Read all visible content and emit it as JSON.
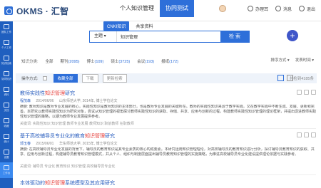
{
  "header": {
    "logo_text": "OKMS · 汇智",
    "nav": [
      "个人知识管理",
      "协同测试"
    ],
    "user_label": "办理耳",
    "user_icon": "user-icon",
    "right_items": [
      "消息",
      "退出"
    ]
  },
  "sidebar": {
    "items": [
      "团队工作",
      "个人工作",
      "知识检索",
      "协同知识",
      "资料",
      "文档",
      "收藏",
      "统计",
      "设置",
      "工作台",
      "更多"
    ]
  },
  "search": {
    "tabs": [
      "CNKI知识",
      "共享资料"
    ],
    "select_value": "主题",
    "input_value": "知识管理",
    "button_label": "检 索"
  },
  "filters": {
    "label": "知识分类:",
    "items": [
      {
        "name": "全部",
        "count": ""
      },
      {
        "name": "期刊",
        "count": "(2095)"
      },
      {
        "name": "博士",
        "count": "(109)"
      },
      {
        "name": "硕士",
        "count": "(3725)"
      },
      {
        "name": "会议",
        "count": "(193)"
      },
      {
        "name": "报纸",
        "count": "(172)"
      }
    ],
    "sort": [
      "排序方式",
      "发表时间"
    ]
  },
  "action_bar": {
    "label": "操作方式:",
    "buttons": [
      "收藏全部",
      "下载",
      "更新检索"
    ],
    "total": "共检到4185条"
  },
  "results": [
    {
      "title_pre": "教师实践性",
      "title_hl": "知识管理",
      "title_post": "研究",
      "author": "程茂森",
      "date": "2014/06/06",
      "source": "山东师范大学, 2014年, 博士学位论文",
      "abstract": "摘要: 教师知识是教师专业发展的核心，实践性知识是教师知识的主体部分，也是教师专业发展的关键所在。教师的实践性知识来源于教学实践，又在教学实践中不断生成、发展、更新和完善。本研究以教师实践性知识为研究对象，尝试从知识管理的视角探讨教师实践性知识的获取、存储、共享、应用与创新的过程，构建教师实践性知识管理的理论框架，并提出促进教师实践性知识管理的策略，以期为教师专业发展提供参考。",
      "keywords": "关键词: 实践性知识 知识管理 教师专业发展 教师知识 职前教师 在职教师"
    },
    {
      "title_pre": "基于高校辅导员专业化的教育",
      "title_hl": "知识管理",
      "title_post": "研究",
      "author": "郭玉春",
      "date": "2015/06/01",
      "source": "华东师范大学, 2015年, 博士学位论文",
      "abstract": "摘要: 在高校辅导员专业化发展的背景下，辅导员的教育知识是其专业素质的核心构成要素。本研究运用知识管理理论，对高校辅导员的教育知识进行分析，探讨辅导员教育知识的获取、共享、应用与创新过程，构建辅导员教育知识管理模式，并从个人、组织与制度层面提出辅导员教育知识管理的实施策略，为推进高校辅导员专业化建设提供理论依据与实践参考。",
      "keywords": "关键词: 辅导员 专业化 教育知识 知识管理 高校辅导员专业化"
    },
    {
      "title_pre": "本体驱动的",
      "title_hl": "知识管理",
      "title_post": "系统模型及其应用研究",
      "author": "",
      "date": "",
      "source": "",
      "abstract": "",
      "keywords": ""
    }
  ]
}
